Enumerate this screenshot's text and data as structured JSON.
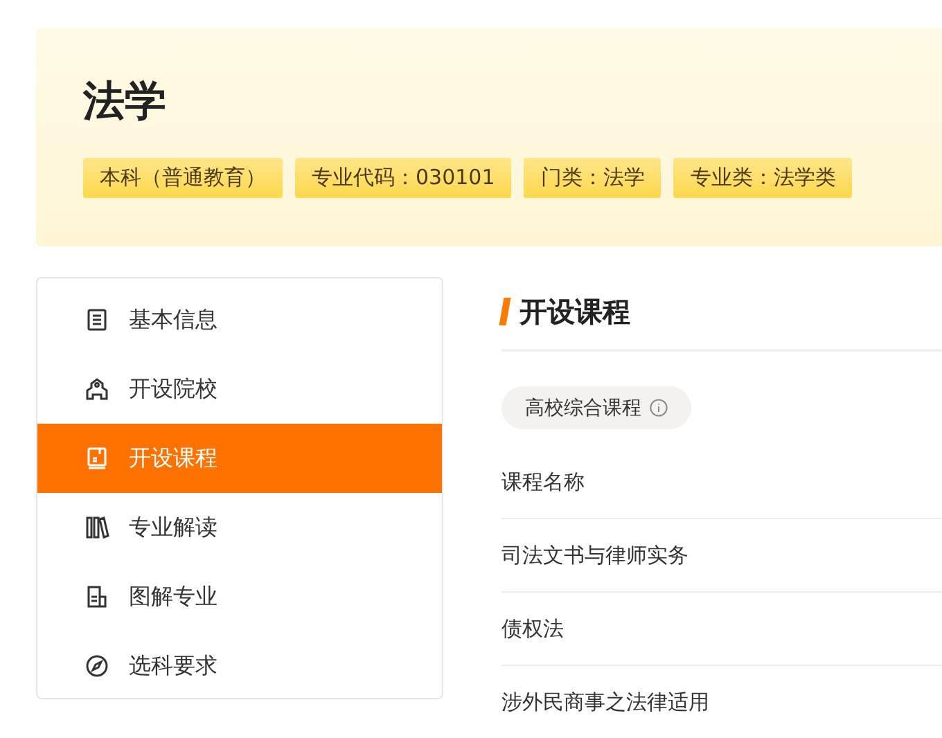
{
  "header": {
    "title": "法学",
    "tags": [
      "本科（普通教育）",
      "专业代码：030101",
      "门类：法学",
      "专业类：法学类"
    ]
  },
  "sidebar": {
    "items": [
      {
        "label": "基本信息",
        "selected": false
      },
      {
        "label": "开设院校",
        "selected": false
      },
      {
        "label": "开设课程",
        "selected": true
      },
      {
        "label": "专业解读",
        "selected": false
      },
      {
        "label": "图解专业",
        "selected": false
      },
      {
        "label": "选科要求",
        "selected": false
      }
    ]
  },
  "section": {
    "title": "开设课程",
    "chip": "高校综合课程",
    "table": {
      "header": "课程名称",
      "rows": [
        "司法文书与律师实务",
        "债权法",
        "涉外民商事之法律适用"
      ]
    }
  }
}
